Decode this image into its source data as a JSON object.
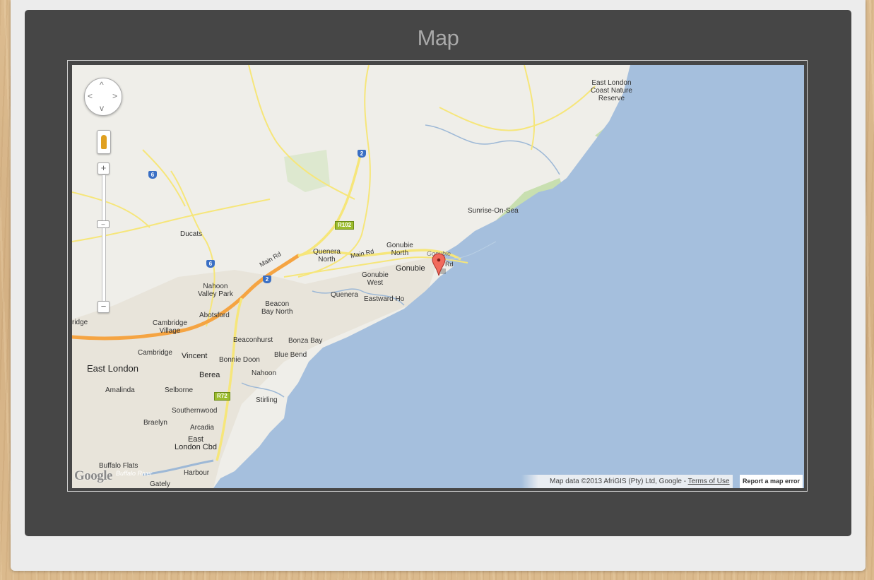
{
  "page": {
    "title": "Map"
  },
  "map": {
    "controls": {
      "pan_icon": "pan-control-icon",
      "streetview_icon": "pegman-icon",
      "zoom_in": "+",
      "zoom_out": "−",
      "zoom_level_fraction": 0.62
    },
    "places": {
      "east_london_reserve": [
        "East London",
        "Coast Nature",
        "Reserve"
      ],
      "sunrise_on_sea": "Sunrise-On-Sea",
      "ducats": "Ducats",
      "gonubie_north": [
        "Gonubie",
        "North"
      ],
      "gonubie_water": "Gonubie",
      "gonubie": "Gonubie",
      "quenera_north": [
        "Quenera",
        "North"
      ],
      "gonubie_west": [
        "Gonubie",
        "West"
      ],
      "nahoon_valley_park": [
        "Nahoon",
        "Valley Park"
      ],
      "beacon_bay_north": [
        "Beacon",
        "Bay North"
      ],
      "quenera": "Quenera",
      "eastward_ho": "Eastward Ho",
      "abotsford": "Abotsford",
      "cambridge_village": [
        "Cambridge",
        "Village"
      ],
      "ridge": "ridge",
      "beaconhurst": "Beaconhurst",
      "bonza_bay": "Bonza Bay",
      "cambridge": "Cambridge",
      "blue_bend": "Blue Bend",
      "east_london": "East London",
      "vincent": "Vincent",
      "bonnie_doon": "Bonnie Doon",
      "amalinda": "Amalinda",
      "berea": "Berea",
      "nahoon": "Nahoon",
      "selborne": "Selborne",
      "stirling": "Stirling",
      "southernwood": "Southernwood",
      "braelyn": "Braelyn",
      "arcadia": "Arcadia",
      "east_london_cbd": [
        "East",
        "London Cbd"
      ],
      "buffalo_flats": "Buffalo Flats",
      "buffalo_river": "Buffalo River",
      "harbour": "Harbour",
      "gately": "Gately"
    },
    "roads": {
      "main_rd_1": "Main Rd",
      "main_rd_2": "Main Rd",
      "rd_partial": "Rd",
      "shield_2_a": "2",
      "shield_2_b": "2",
      "shield_6_a": "6",
      "shield_6_b": "6",
      "r102": "R102",
      "r72": "R72"
    },
    "marker_icon": "map-marker-icon",
    "logo": "Google",
    "attribution_text": "Map data ©2013 AfriGIS (Pty) Ltd, Google - ",
    "terms_link": "Terms of Use",
    "report_link": "Report a map error",
    "colors": {
      "water": "#a5bfdd",
      "land": "#efeee9",
      "major_road": "#f5a442",
      "minor_road": "#f6e67a",
      "park": "#c8dfb0"
    }
  }
}
